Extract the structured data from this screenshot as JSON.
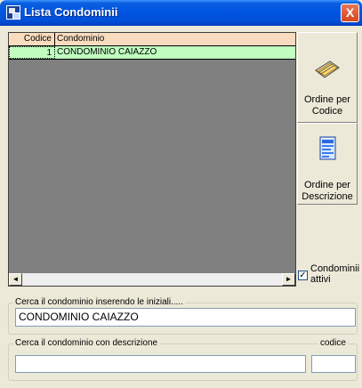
{
  "window": {
    "title": "Lista Condominii",
    "close_label": "X"
  },
  "grid": {
    "columns": [
      "Codice",
      "Condominio"
    ],
    "rows": [
      {
        "codice": "1",
        "condominio": "CONDOMINIO CAIAZZO"
      }
    ]
  },
  "scroll": {
    "left_arrow": "◄",
    "right_arrow": "►"
  },
  "side": {
    "order_code_label": "Ordine per Codice",
    "order_desc_label": "Ordine per Descrizione",
    "active_label": "Condominii attivi",
    "active_checked": true
  },
  "search": {
    "initials_label": "Cerca il condominio inserendo le iniziali.....",
    "initials_value": "CONDOMINIO CAIAZZO",
    "description_label": "Cerca il condominio con descrizione",
    "description_value": "",
    "code_label": "codice",
    "code_value": ""
  }
}
